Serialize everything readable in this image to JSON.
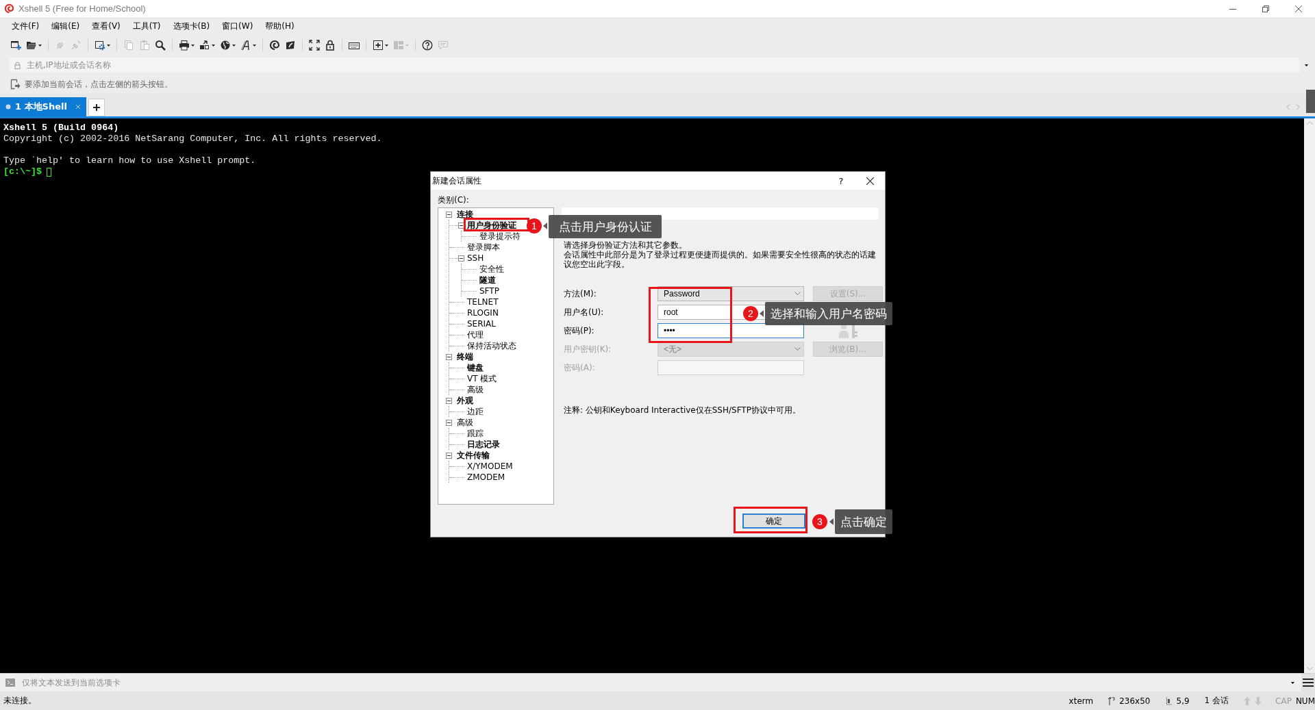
{
  "window": {
    "title": "Xshell 5 (Free for Home/School)"
  },
  "menu": [
    "文件(F)",
    "编辑(E)",
    "查看(V)",
    "工具(T)",
    "选项卡(B)",
    "窗口(W)",
    "帮助(H)"
  ],
  "toolbar": [
    {
      "kind": "new",
      "dropdown": false,
      "disabled": false
    },
    {
      "kind": "open",
      "dropdown": true,
      "disabled": false
    },
    {
      "kind": "separator"
    },
    {
      "kind": "connect",
      "dropdown": false,
      "disabled": true
    },
    {
      "kind": "disconnect",
      "dropdown": false,
      "disabled": true
    },
    {
      "kind": "separator"
    },
    {
      "kind": "properties",
      "dropdown": true,
      "disabled": false
    },
    {
      "kind": "separator"
    },
    {
      "kind": "copy",
      "dropdown": false,
      "disabled": true
    },
    {
      "kind": "paste",
      "dropdown": false,
      "disabled": true
    },
    {
      "kind": "find",
      "dropdown": false,
      "disabled": false
    },
    {
      "kind": "separator"
    },
    {
      "kind": "print",
      "dropdown": true,
      "disabled": false
    },
    {
      "kind": "transfer",
      "dropdown": true,
      "disabled": false
    },
    {
      "kind": "globe",
      "dropdown": true,
      "disabled": false
    },
    {
      "kind": "pen",
      "dropdown": true,
      "disabled": false
    },
    {
      "kind": "separator"
    },
    {
      "kind": "swirl",
      "dropdown": false,
      "disabled": false
    },
    {
      "kind": "leaf",
      "dropdown": false,
      "disabled": false
    },
    {
      "kind": "separator"
    },
    {
      "kind": "fullscreen",
      "dropdown": false,
      "disabled": false
    },
    {
      "kind": "lock",
      "dropdown": false,
      "disabled": false
    },
    {
      "kind": "separator"
    },
    {
      "kind": "keyboard",
      "dropdown": false,
      "disabled": false
    },
    {
      "kind": "separator"
    },
    {
      "kind": "newtab",
      "dropdown": true,
      "disabled": false
    },
    {
      "kind": "layout",
      "dropdown": true,
      "disabled": true
    },
    {
      "kind": "separator"
    },
    {
      "kind": "help",
      "dropdown": false,
      "disabled": false
    },
    {
      "kind": "chat",
      "dropdown": false,
      "disabled": true
    }
  ],
  "address_bar": {
    "placeholder": "主机,IP地址或会话名称"
  },
  "hint_bar": {
    "text": "要添加当前会话，点击左侧的箭头按钮。"
  },
  "tabs": [
    {
      "label": "1 本地Shell",
      "selected": true
    }
  ],
  "terminal": {
    "lines": [
      {
        "kind": "heading",
        "text": "Xshell 5 (Build 0964)"
      },
      {
        "kind": "plain",
        "text": "Copyright (c) 2002-2016 NetSarang Computer, Inc. All rights reserved."
      },
      {
        "kind": "blank"
      },
      {
        "kind": "plain",
        "text": "Type `help' to learn how to use Xshell prompt."
      },
      {
        "kind": "prompt",
        "text": "[c:\\~]$"
      }
    ]
  },
  "dialog": {
    "title": "新建会话属性",
    "help": "?",
    "category_label": "类别(C):",
    "tree": [
      {
        "label": "连接",
        "emphasized": true,
        "selected": false,
        "expanded": true,
        "children": [
          {
            "label": "用户身份验证",
            "emphasized": true,
            "selected": true,
            "expanded": true,
            "children": [
              {
                "label": "登录提示符",
                "emphasized": false,
                "selected": false
              }
            ]
          },
          {
            "label": "登录脚本",
            "emphasized": false,
            "selected": false
          },
          {
            "label": "SSH",
            "emphasized": false,
            "selected": false,
            "expanded": true,
            "children": [
              {
                "label": "安全性",
                "emphasized": false,
                "selected": false
              },
              {
                "label": "隧道",
                "emphasized": true,
                "selected": false
              },
              {
                "label": "SFTP",
                "emphasized": false,
                "selected": false
              }
            ]
          },
          {
            "label": "TELNET",
            "emphasized": false,
            "selected": false
          },
          {
            "label": "RLOGIN",
            "emphasized": false,
            "selected": false
          },
          {
            "label": "SERIAL",
            "emphasized": false,
            "selected": false
          },
          {
            "label": "代理",
            "emphasized": false,
            "selected": false
          },
          {
            "label": "保持活动状态",
            "emphasized": false,
            "selected": false
          }
        ]
      },
      {
        "label": "终端",
        "emphasized": true,
        "selected": false,
        "expanded": true,
        "children": [
          {
            "label": "键盘",
            "emphasized": true,
            "selected": false
          },
          {
            "label": "VT 模式",
            "emphasized": false,
            "selected": false
          },
          {
            "label": "高级",
            "emphasized": false,
            "selected": false
          }
        ]
      },
      {
        "label": "外观",
        "emphasized": true,
        "selected": false,
        "expanded": true,
        "children": [
          {
            "label": "边距",
            "emphasized": false,
            "selected": false
          }
        ]
      },
      {
        "label": "高级",
        "emphasized": false,
        "selected": false,
        "expanded": true,
        "children": [
          {
            "label": "跟踪",
            "emphasized": false,
            "selected": false
          },
          {
            "label": "日志记录",
            "emphasized": true,
            "selected": false
          }
        ]
      },
      {
        "label": "文件传输",
        "emphasized": true,
        "selected": false,
        "expanded": true,
        "children": [
          {
            "label": "X/YMODEM",
            "emphasized": false,
            "selected": false
          },
          {
            "label": "ZMODEM",
            "emphasized": false,
            "selected": false
          }
        ]
      }
    ],
    "description": [
      "请选择身份验证方法和其它参数。",
      "会话属性中此部分是为了登录过程更便捷而提供的。如果需要安全性很高的状态的话建议您空出此字段。"
    ],
    "fields": [
      {
        "label": "方法(M):",
        "kind": "select",
        "value": "Password",
        "disabled": false,
        "focused": false,
        "button": {
          "label": "设置(S)...",
          "disabled": true
        }
      },
      {
        "label": "用户名(U):",
        "kind": "text",
        "value": "root",
        "disabled": false,
        "focused": false
      },
      {
        "label": "密码(P):",
        "kind": "password",
        "value": "••••",
        "disabled": false,
        "focused": true
      },
      {
        "label": "用户密钥(K):",
        "kind": "select",
        "value": "<无>",
        "disabled": true,
        "focused": false,
        "button": {
          "label": "浏览(B)...",
          "disabled": true
        }
      },
      {
        "label": "密码(A):",
        "kind": "password",
        "disabled": true,
        "focused": false
      }
    ],
    "note": "注释: 公钥和Keyboard Interactive仅在SSH/SFTP协议中可用。",
    "ok_button": "确定"
  },
  "annotations": [
    {
      "number": "1",
      "text": "点击用户身份认证"
    },
    {
      "number": "2",
      "text": "选择和输入用户名密码"
    },
    {
      "number": "3",
      "text": "点击确定"
    }
  ],
  "send_bar": {
    "placeholder": "仅将文本发送到当前选项卡"
  },
  "status_bar": {
    "message": "未连接。",
    "terminal_type": "xterm",
    "size": "236x50",
    "cursor": "5,9",
    "sessions": "1 会话",
    "indicators": [
      {
        "label": "CAP",
        "on": false
      },
      {
        "label": "NUM",
        "on": true
      }
    ]
  }
}
